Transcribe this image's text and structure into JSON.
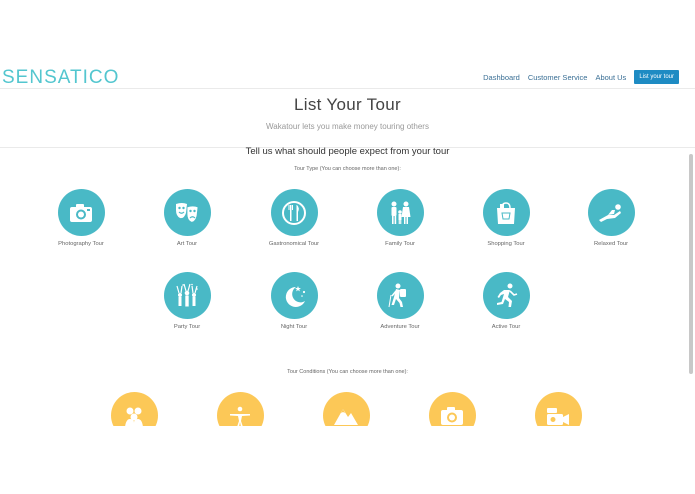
{
  "brand": {
    "logo": "SENSATICO"
  },
  "nav": {
    "links": [
      "Dashboard",
      "Customer Service",
      "About Us"
    ],
    "cta": "List your tour"
  },
  "hero": {
    "title": "List Your Tour",
    "subtitle": "Wakatour lets you make money touring others"
  },
  "section": {
    "title": "Tell us what should people expect from your tour",
    "tour_type_label": "Tour Type (You can choose more than one):",
    "tour_conditions_label": "Tour Conditions (You can choose more than one):"
  },
  "tour_types": [
    {
      "label": "Photography Tour",
      "icon": "camera-icon"
    },
    {
      "label": "Art Tour",
      "icon": "theater-masks-icon"
    },
    {
      "label": "Gastronomical Tour",
      "icon": "plate-cutlery-icon"
    },
    {
      "label": "Family Tour",
      "icon": "family-icon"
    },
    {
      "label": "Shopping Tour",
      "icon": "shopping-bag-icon"
    },
    {
      "label": "Relaxed Tour",
      "icon": "reclining-person-icon"
    },
    {
      "label": "Party Tour",
      "icon": "party-crowd-icon"
    },
    {
      "label": "Night Tour",
      "icon": "moon-stars-icon"
    },
    {
      "label": "Adventure Tour",
      "icon": "hiker-icon"
    },
    {
      "label": "Active Tour",
      "icon": "runner-icon"
    }
  ],
  "tour_conditions": [
    {
      "icon": "group-icon"
    },
    {
      "icon": "yoga-pose-icon"
    },
    {
      "icon": "mountains-icon"
    },
    {
      "icon": "camera-icon"
    },
    {
      "icon": "video-camera-icon"
    }
  ],
  "colors": {
    "teal": "#49b9c6",
    "yellow": "#fcc857",
    "cta": "#1e8bc3",
    "logo": "#53c6cf"
  }
}
